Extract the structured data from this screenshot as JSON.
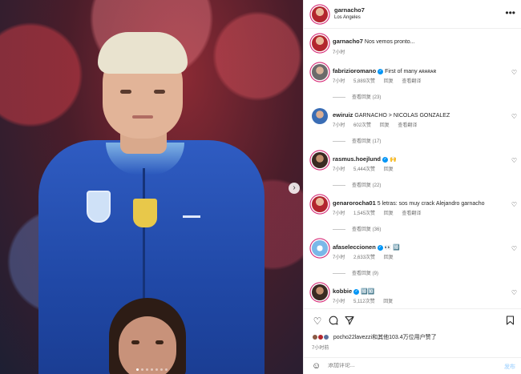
{
  "header": {
    "username": "garnacho7",
    "location": "Los Angeles",
    "more_icon": "more-horizontal-icon"
  },
  "caption": {
    "username": "garnacho7",
    "text": "Nos vemos pronto...",
    "time": "7小时"
  },
  "comments": [
    {
      "username": "fabrizioromano",
      "verified": true,
      "text": "First of many ᴀʀᴀʀᴀʀ",
      "time": "7小时",
      "likes": "5,889次赞",
      "reply": "回复",
      "translate": "查看翻译",
      "replies": "查看回复 (23)"
    },
    {
      "username": "ewiruiz",
      "verified": false,
      "text": "GARNACHO > NICOLAS GONZALEZ",
      "time": "7小时",
      "likes": "602次赞",
      "reply": "回复",
      "translate": "查看翻译",
      "replies": "查看回复 (17)"
    },
    {
      "username": "rasmus.hoejlund",
      "verified": true,
      "text": "🙌",
      "time": "7小时",
      "likes": "5,444次赞",
      "reply": "回复",
      "translate": "",
      "replies": "查看回复 (22)"
    },
    {
      "username": "genarorocha01",
      "verified": false,
      "text": "5 letras: sos muy crack Alejandro garnacho",
      "time": "7小时",
      "likes": "1,545次赞",
      "reply": "回复",
      "translate": "查看翻译",
      "replies": "查看回复 (36)"
    },
    {
      "username": "afaseleccionen",
      "verified": true,
      "text": "👀 🔟",
      "time": "7小时",
      "likes": "2,633次赞",
      "reply": "回复",
      "translate": "",
      "replies": "查看回复 (9)"
    },
    {
      "username": "kobbie",
      "verified": true,
      "text": "🔟🔟",
      "time": "7小时",
      "likes": "5,112次赞",
      "reply": "回复",
      "translate": "",
      "replies": ""
    }
  ],
  "actions": {
    "liked_by": "pocho22lavezzi和其他103.4万位用户赞了",
    "posted": "7小时前"
  },
  "comment_box": {
    "placeholder": "添加评论...",
    "post_label": "发布"
  }
}
